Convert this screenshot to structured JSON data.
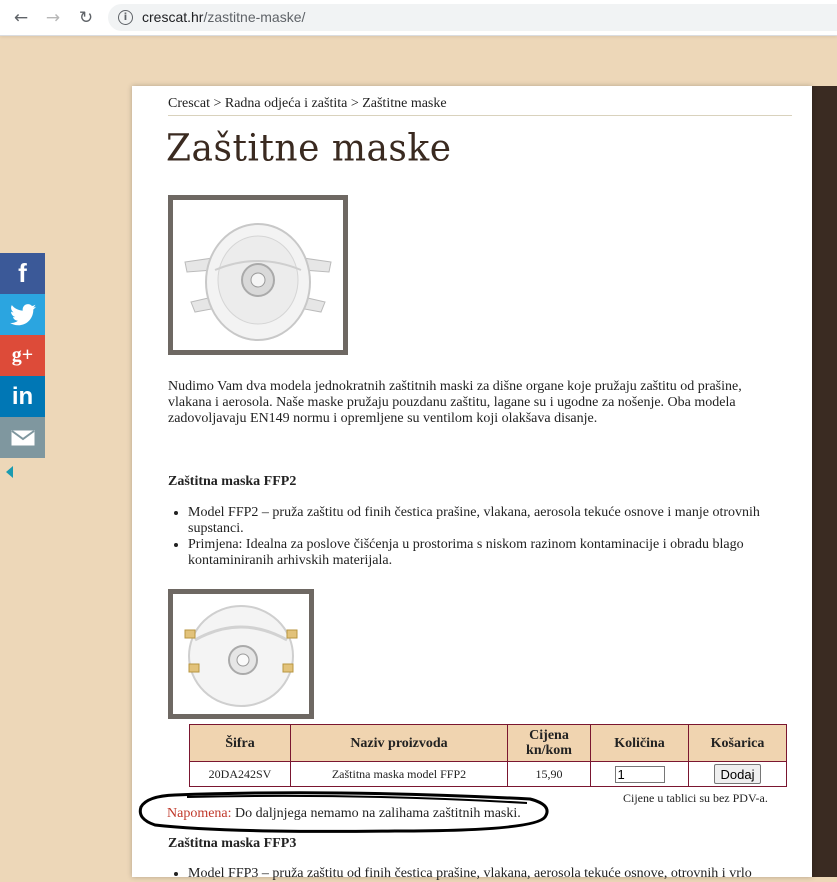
{
  "browser": {
    "url_domain": "crescat.hr",
    "url_path": "/zastitne-maske/"
  },
  "breadcrumb": "Crescat > Radna odjeća i zaštita > Zaštitne maske",
  "page_title": "Zaštitne maske",
  "intro": "Nudimo Vam dva modela jednokratnih zaštitnih maski za dišne organe koje pružaju zaštitu od prašine, vlakana i aerosola. Naše maske pružaju pouzdanu zaštitu, lagane su i ugodne za nošenje. Oba modela zadovoljavaju EN149 normu i opremljene su ventilom koji olakšava disanje.",
  "ffp2": {
    "heading": "Zaštitna maska FFP2",
    "bullets": [
      "Model FFP2 – pruža zaštitu od finih čestica prašine, vlakana, aerosola tekuće osnove i manje otrovnih supstanci.",
      "Primjena: Idealna za poslove čišćenja u prostorima s niskom razinom kontaminacije i obradu blago kontaminiranih arhivskih materijala."
    ]
  },
  "table": {
    "headers": [
      "Šifra",
      "Naziv proizvoda",
      "Cijena kn/kom",
      "Količina",
      "Košarica"
    ],
    "row": {
      "code": "20DA242SV",
      "name": "Zaštitna maska model FFP2",
      "price": "15,90",
      "quantity": "1",
      "button": "Dodaj"
    }
  },
  "vat_note": "Cijene u tablici su bez PDV-a.",
  "note": {
    "label": "Napomena:",
    "text": "Do daljnjega nemamo na zalihama zaštitnih maski."
  },
  "ffp3": {
    "heading": "Zaštitna maska FFP3",
    "bullet": "Model FFP3 – pruža zaštitu od finih čestica prašine, vlakana, aerosola tekuće osnove, otrovnih i vrlo"
  },
  "social": [
    {
      "icon": "facebook-icon",
      "glyph": "f",
      "color": "#3b5998"
    },
    {
      "icon": "twitter-icon",
      "glyph": "🐦",
      "color": "#1da1f2"
    },
    {
      "icon": "google-plus-icon",
      "glyph": "G+",
      "color": "#dd4b39"
    },
    {
      "icon": "linkedin-icon",
      "glyph": "in",
      "color": "#0077b5"
    },
    {
      "icon": "email-icon",
      "glyph": "✉",
      "color": "#849ba3"
    }
  ]
}
